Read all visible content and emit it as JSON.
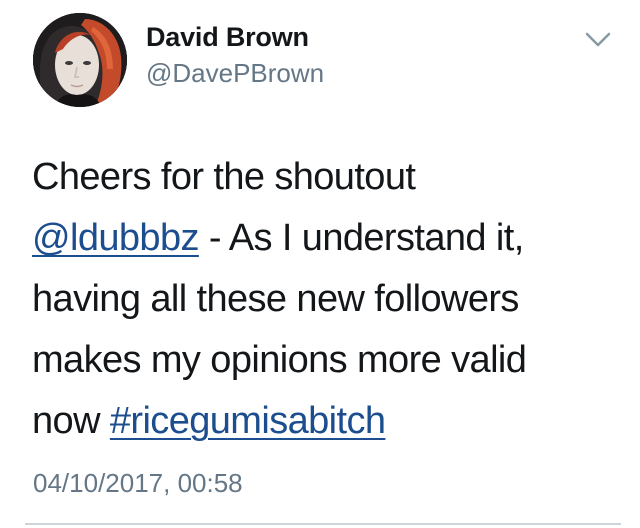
{
  "tweet": {
    "author": {
      "display_name": "David Brown",
      "handle": "@DavePBrown"
    },
    "text": {
      "line1": "Cheers for the shoutout",
      "mention": "@ldubbbz",
      "line2_rest": " - As I understand it,",
      "line3": "having all these new followers",
      "line4": "makes my opinions more valid",
      "line5_prefix": "now ",
      "hashtag": "#ricegumisabitch"
    },
    "timestamp": "04/10/2017, 00:58",
    "menu_icon": "chevron-down-icon",
    "link_color": "#1c4e8f",
    "muted_color": "#657786"
  }
}
